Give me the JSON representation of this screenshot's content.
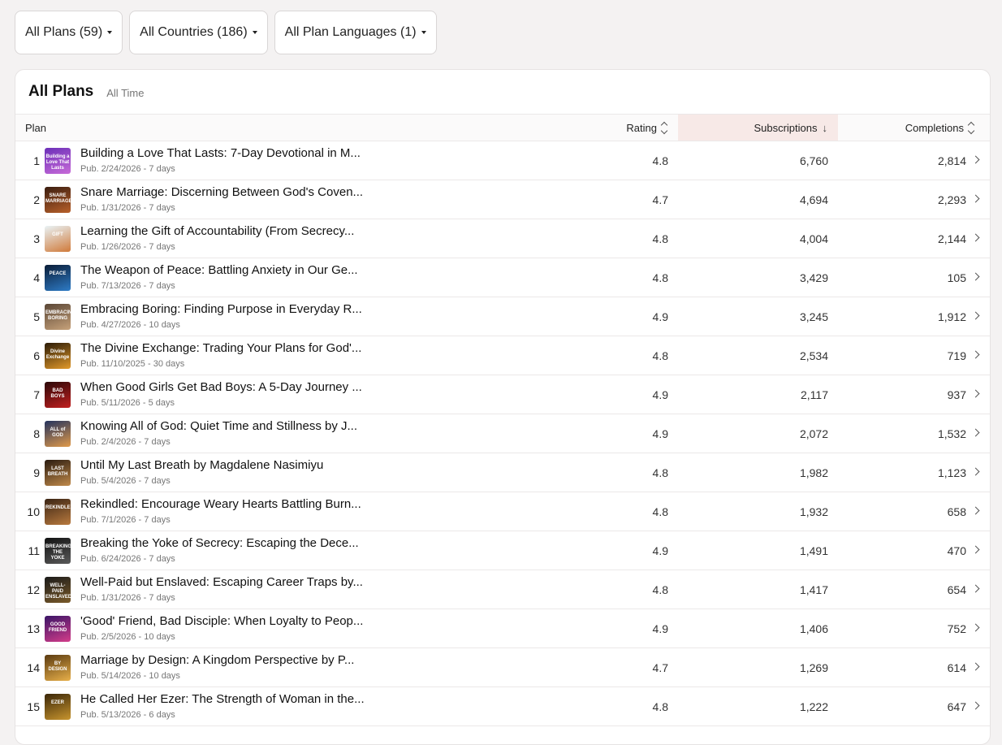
{
  "filters": [
    {
      "label": "All Plans (59)"
    },
    {
      "label": "All Countries (186)"
    },
    {
      "label": "All Plan Languages (1)"
    }
  ],
  "card": {
    "title": "All Plans",
    "subtitle": "All Time"
  },
  "table": {
    "columns": {
      "plan": "Plan",
      "rating": "Rating",
      "subscriptions": "Subscriptions",
      "completions": "Completions"
    },
    "sorted_column": "subscriptions",
    "sort_direction": "descending",
    "rows": [
      {
        "rank": "1",
        "title": "Building a Love That Lasts: 7-Day Devotional in M...",
        "meta": "Pub. 2/24/2026 - 7 days",
        "rating": "4.8",
        "subscriptions": "6,760",
        "completions": "2,814",
        "thumb_text": "Building a Love That Lasts",
        "thumb_colors": [
          "#6b2fb8",
          "#c86bd8"
        ]
      },
      {
        "rank": "2",
        "title": "Snare Marriage: Discerning Between God's Coven...",
        "meta": "Pub. 1/31/2026 - 7 days",
        "rating": "4.7",
        "subscriptions": "4,694",
        "completions": "2,293",
        "thumb_text": "SNARE MARRIAGE",
        "thumb_colors": [
          "#3a1d10",
          "#b9602a"
        ]
      },
      {
        "rank": "3",
        "title": "Learning the Gift of Accountability (From Secrecy...",
        "meta": "Pub. 1/26/2026 - 7 days",
        "rating": "4.8",
        "subscriptions": "4,004",
        "completions": "2,144",
        "thumb_text": "GIFT",
        "thumb_colors": [
          "#e9f3f6",
          "#d07a3a"
        ]
      },
      {
        "rank": "4",
        "title": "The Weapon of Peace: Battling Anxiety in Our Ge...",
        "meta": "Pub. 7/13/2026 - 7 days",
        "rating": "4.8",
        "subscriptions": "3,429",
        "completions": "105",
        "thumb_text": "PEACE",
        "thumb_colors": [
          "#0a1c36",
          "#2e7cc7"
        ]
      },
      {
        "rank": "5",
        "title": "Embracing Boring: Finding Purpose in Everyday R...",
        "meta": "Pub. 4/27/2026 - 10 days",
        "rating": "4.9",
        "subscriptions": "3,245",
        "completions": "1,912",
        "thumb_text": "EMBRACING BORING",
        "thumb_colors": [
          "#5a4636",
          "#c7a27a"
        ]
      },
      {
        "rank": "6",
        "title": "The Divine Exchange: Trading Your Plans for God'...",
        "meta": "Pub. 11/10/2025 - 30 days",
        "rating": "4.8",
        "subscriptions": "2,534",
        "completions": "719",
        "thumb_text": "Divine Exchange",
        "thumb_colors": [
          "#2a1a06",
          "#e29a2a"
        ]
      },
      {
        "rank": "7",
        "title": "When Good Girls Get Bad Boys: A 5-Day Journey ...",
        "meta": "Pub. 5/11/2026 - 5 days",
        "rating": "4.9",
        "subscriptions": "2,117",
        "completions": "937",
        "thumb_text": "BAD BOYS",
        "thumb_colors": [
          "#2b0808",
          "#c21f1f"
        ]
      },
      {
        "rank": "8",
        "title": "Knowing All of God: Quiet Time and Stillness by J...",
        "meta": "Pub. 2/4/2026 - 7 days",
        "rating": "4.9",
        "subscriptions": "2,072",
        "completions": "1,532",
        "thumb_text": "ALL of GOD",
        "thumb_colors": [
          "#24335e",
          "#e09a4a"
        ]
      },
      {
        "rank": "9",
        "title": "Until My Last Breath by Magdalene Nasimiyu",
        "meta": "Pub. 5/4/2026 - 7 days",
        "rating": "4.8",
        "subscriptions": "1,982",
        "completions": "1,123",
        "thumb_text": "LAST BREATH",
        "thumb_colors": [
          "#2a1b10",
          "#c08a4a"
        ]
      },
      {
        "rank": "10",
        "title": "Rekindled: Encourage Weary Hearts Battling Burn...",
        "meta": "Pub. 7/1/2026 - 7 days",
        "rating": "4.8",
        "subscriptions": "1,932",
        "completions": "658",
        "thumb_text": "REKINDLED",
        "thumb_colors": [
          "#3a2414",
          "#b97a3e"
        ]
      },
      {
        "rank": "11",
        "title": "Breaking the Yoke of Secrecy: Escaping the Dece...",
        "meta": "Pub. 6/24/2026 - 7 days",
        "rating": "4.9",
        "subscriptions": "1,491",
        "completions": "470",
        "thumb_text": "BREAKING THE YOKE",
        "thumb_colors": [
          "#111111",
          "#5a5a5a"
        ]
      },
      {
        "rank": "12",
        "title": "Well-Paid but Enslaved: Escaping Career Traps by...",
        "meta": "Pub. 1/31/2026 - 7 days",
        "rating": "4.8",
        "subscriptions": "1,417",
        "completions": "654",
        "thumb_text": "WELL-PAID ENSLAVED",
        "thumb_colors": [
          "#1a1a1a",
          "#7a5a2a"
        ]
      },
      {
        "rank": "13",
        "title": "'Good' Friend, Bad Disciple: When Loyalty to Peop...",
        "meta": "Pub. 2/5/2026 - 10 days",
        "rating": "4.9",
        "subscriptions": "1,406",
        "completions": "752",
        "thumb_text": "GOOD FRIEND",
        "thumb_colors": [
          "#3a1466",
          "#d43d8a"
        ]
      },
      {
        "rank": "14",
        "title": "Marriage by Design: A Kingdom Perspective by P...",
        "meta": "Pub. 5/14/2026 - 10 days",
        "rating": "4.7",
        "subscriptions": "1,269",
        "completions": "614",
        "thumb_text": "BY DESIGN",
        "thumb_colors": [
          "#5a3a10",
          "#e8b04a"
        ]
      },
      {
        "rank": "15",
        "title": "He Called Her Ezer: The Strength of Woman in the...",
        "meta": "Pub. 5/13/2026 - 6 days",
        "rating": "4.8",
        "subscriptions": "1,222",
        "completions": "647",
        "thumb_text": "EZER",
        "thumb_colors": [
          "#3a2608",
          "#c8952e"
        ]
      }
    ]
  }
}
